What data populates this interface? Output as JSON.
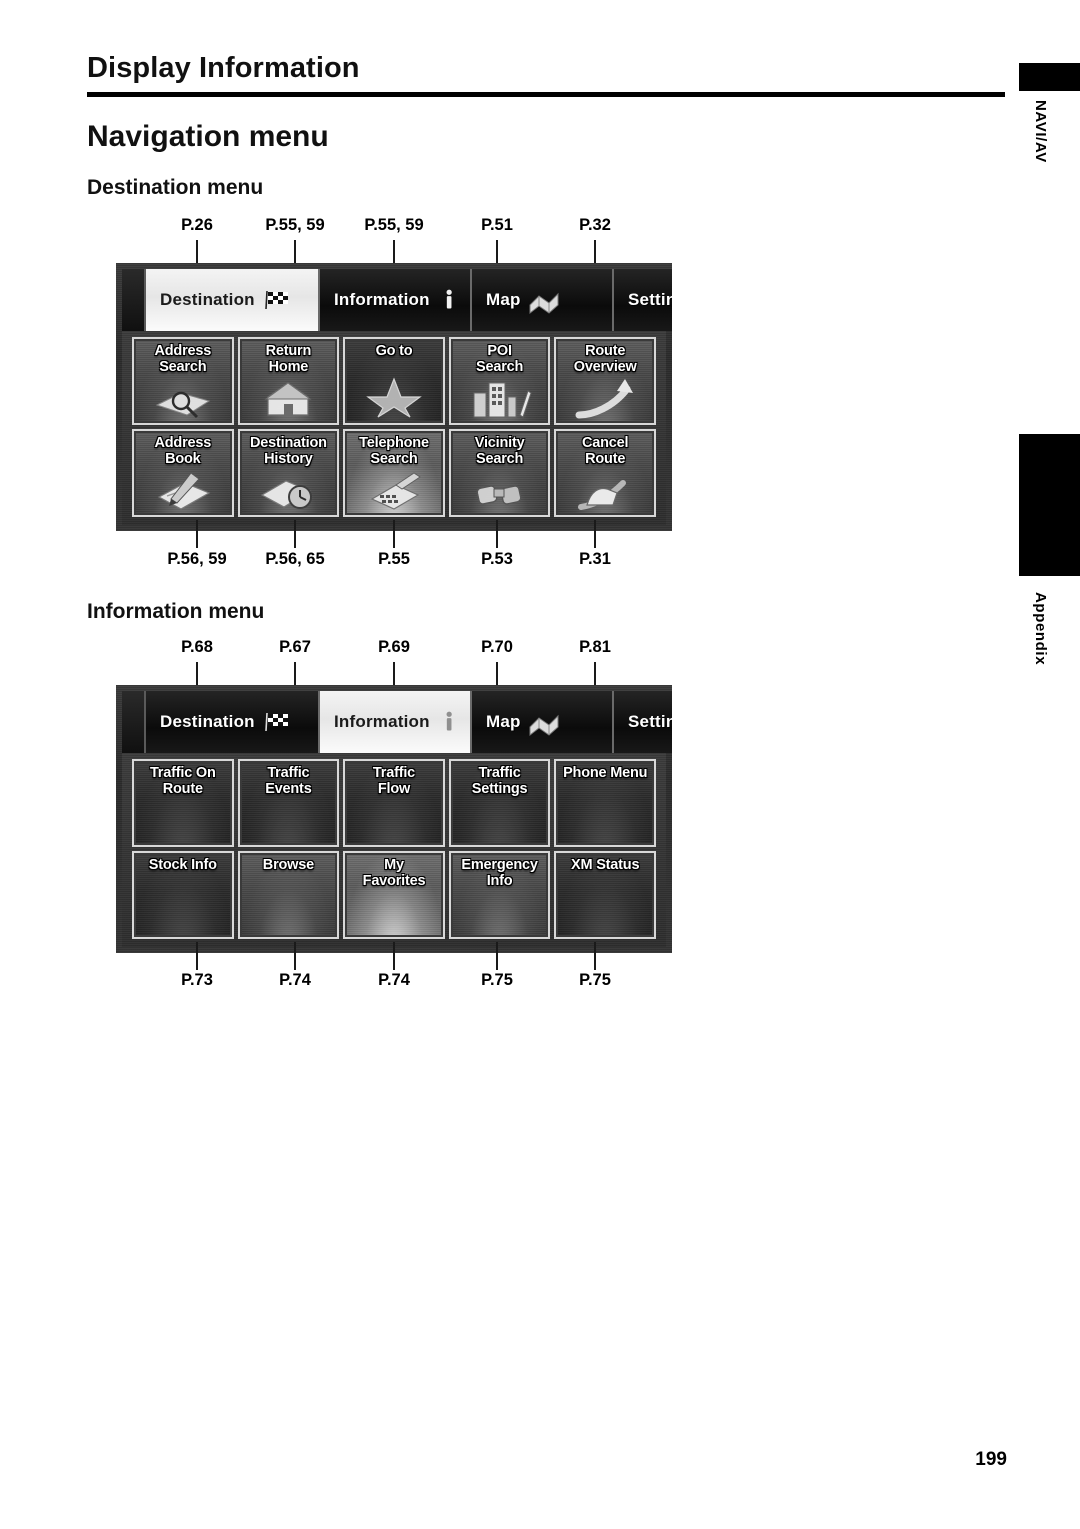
{
  "document": {
    "header_title": "Display Information",
    "section_title": "Navigation menu",
    "page_number": "199"
  },
  "edge_tabs": [
    {
      "label": "NAVI/AV"
    },
    {
      "label": "Appendix"
    }
  ],
  "subsections": [
    {
      "id": "destination",
      "heading": "Destination menu",
      "callouts_top": [
        "P.26",
        "P.55, 59",
        "P.55, 59",
        "P.51",
        "P.32"
      ],
      "callouts_bottom": [
        "P.56, 59",
        "P.56, 65",
        "P.55",
        "P.53",
        "P.31"
      ],
      "screen": {
        "tabs": [
          {
            "label": "Destination",
            "icon": "checkered-flag-icon",
            "active": true
          },
          {
            "label": "Information",
            "icon": "info-i-icon",
            "active": false
          },
          {
            "label": "Map",
            "icon": "folded-map-icon",
            "active": false
          },
          {
            "label": "Settings",
            "icon": "gear-icon",
            "active": false
          }
        ],
        "buttons": [
          {
            "label": "Address\nSearch",
            "icon": "map-magnifier-icon",
            "tone": "normal"
          },
          {
            "label": "Return\nHome",
            "icon": "house-icon",
            "tone": "normal"
          },
          {
            "label": "Go to",
            "icon": "star-icon",
            "tone": "dim"
          },
          {
            "label": "POI\nSearch",
            "icon": "buildings-icon",
            "tone": "normal"
          },
          {
            "label": "Route\nOverview",
            "icon": "route-arrow-icon",
            "tone": "normal"
          },
          {
            "label": "Address\nBook",
            "icon": "notebook-pen-icon",
            "tone": "normal"
          },
          {
            "label": "Destination\nHistory",
            "icon": "clock-page-icon",
            "tone": "normal"
          },
          {
            "label": "Telephone\nSearch",
            "icon": "telephone-icon",
            "tone": "bright"
          },
          {
            "label": "Vicinity\nSearch",
            "icon": "binoculars-icon",
            "tone": "normal"
          },
          {
            "label": "Cancel\nRoute",
            "icon": "cancel-hand-icon",
            "tone": "normal"
          }
        ]
      }
    },
    {
      "id": "information",
      "heading": "Information menu",
      "callouts_top": [
        "P.68",
        "P.67",
        "P.69",
        "P.70",
        "P.81"
      ],
      "callouts_bottom": [
        "P.73",
        "P.74",
        "P.74",
        "P.75",
        "P.75"
      ],
      "screen": {
        "tabs": [
          {
            "label": "Destination",
            "icon": "checkered-flag-icon",
            "active": false
          },
          {
            "label": "Information",
            "icon": "info-i-icon",
            "active": true
          },
          {
            "label": "Map",
            "icon": "folded-map-icon",
            "active": false
          },
          {
            "label": "Settings",
            "icon": "gear-icon",
            "active": false
          }
        ],
        "buttons": [
          {
            "label": "Traffic On\nRoute",
            "icon": "none",
            "tone": "dim"
          },
          {
            "label": "Traffic\nEvents",
            "icon": "none",
            "tone": "dim"
          },
          {
            "label": "Traffic\nFlow",
            "icon": "none",
            "tone": "dim"
          },
          {
            "label": "Traffic\nSettings",
            "icon": "none",
            "tone": "dim"
          },
          {
            "label": "Phone Menu",
            "icon": "none",
            "tone": "dim"
          },
          {
            "label": "Stock Info",
            "icon": "none",
            "tone": "dim"
          },
          {
            "label": "Browse",
            "icon": "none",
            "tone": "normal"
          },
          {
            "label": "My\nFavorites",
            "icon": "none",
            "tone": "bright"
          },
          {
            "label": "Emergency\nInfo",
            "icon": "none",
            "tone": "normal"
          },
          {
            "label": "XM Status",
            "icon": "none",
            "tone": "dim"
          }
        ]
      }
    }
  ],
  "colors": {
    "ink": "#000000",
    "paper": "#ffffff",
    "screen_dark": "#2f2f2f",
    "button_border": "#d8d8d8",
    "tab_active_bg": "#f2f2f2"
  }
}
